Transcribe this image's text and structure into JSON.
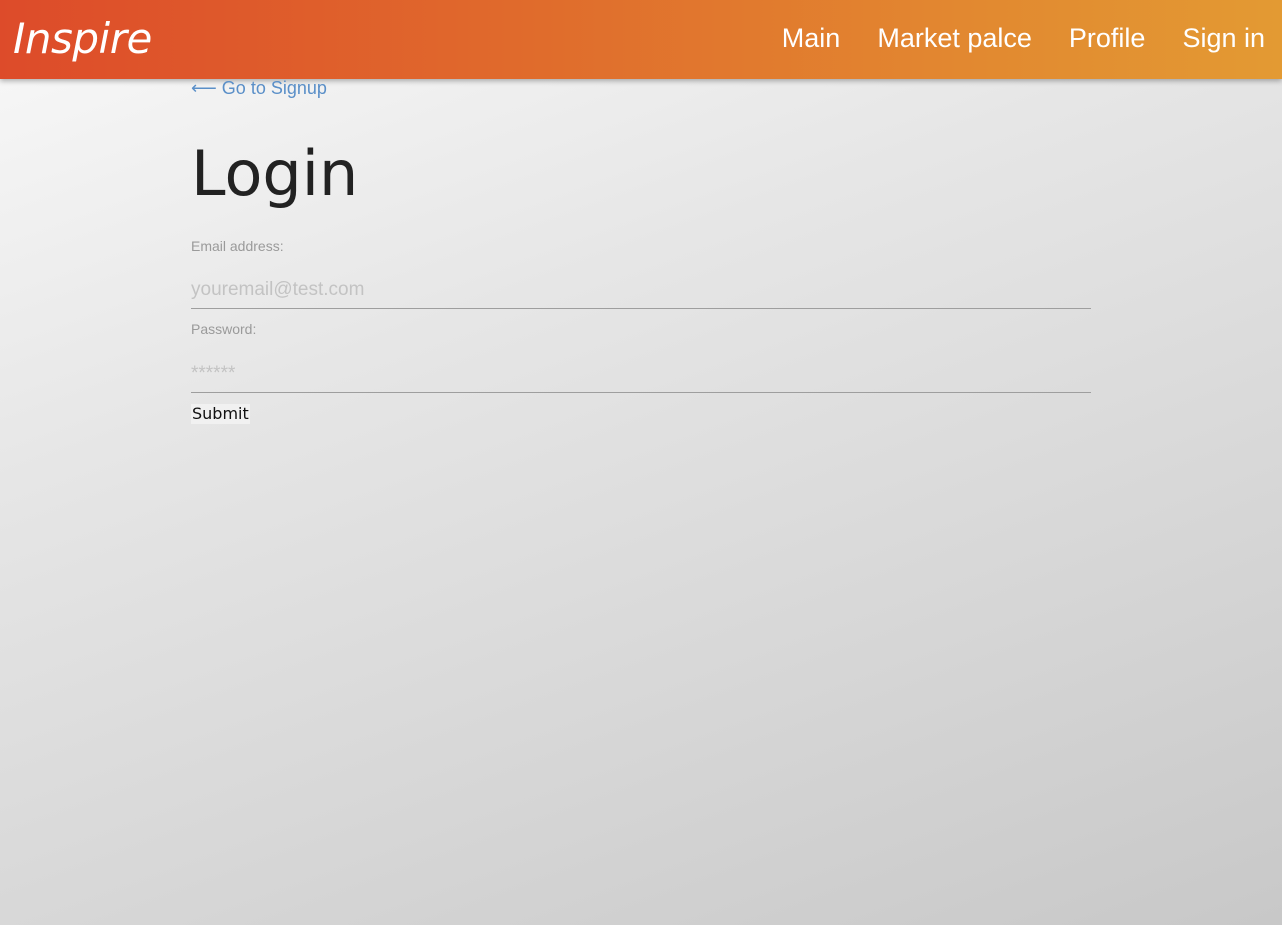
{
  "navbar": {
    "brand": "Inspire",
    "links": [
      {
        "label": "Main"
      },
      {
        "label": "Market palce"
      },
      {
        "label": "Profile"
      },
      {
        "label": "Sign in"
      }
    ],
    "colors": {
      "gradient_start": "#dd4b2a",
      "gradient_end": "#e39a33",
      "text": "#ffffff"
    }
  },
  "page": {
    "back_link": "⟵ Go to Signup",
    "title": "Login",
    "link_color": "#5a8fc8"
  },
  "form": {
    "email": {
      "label": "Email address:",
      "placeholder": "youremail@test.com",
      "value": ""
    },
    "password": {
      "label": "Password:",
      "placeholder": "******",
      "value": ""
    },
    "submit_label": "Submit"
  }
}
